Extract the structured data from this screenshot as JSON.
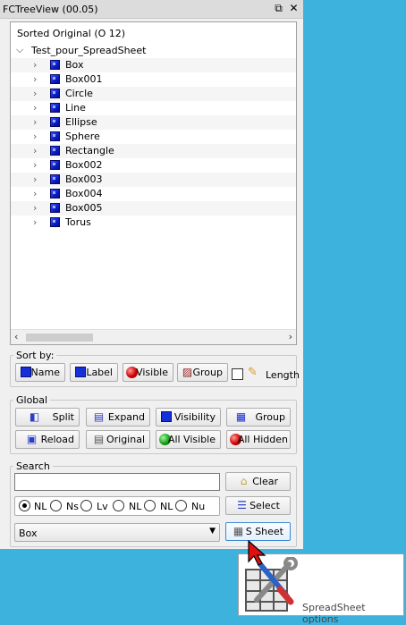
{
  "window": {
    "title": "FCTreeView (00.05)"
  },
  "tree": {
    "header": "Sorted Original (O 12)",
    "root": "Test_pour_SpreadSheet",
    "items": [
      "Box",
      "Box001",
      "Circle",
      "Line",
      "Ellipse",
      "Sphere",
      "Rectangle",
      "Box002",
      "Box003",
      "Box004",
      "Box005",
      "Torus"
    ]
  },
  "sort": {
    "legend": "Sort by:",
    "name": "Name",
    "label": "Label",
    "visible": "Visible",
    "group": "Group",
    "length": "Length"
  },
  "global": {
    "legend": "Global",
    "split": "Split",
    "expand": "Expand",
    "visibility": "Visibility",
    "group": "Group",
    "reload": "Reload",
    "original": "Original",
    "all_visible": "All Visible",
    "all_hidden": "All Hidden"
  },
  "search": {
    "legend": "Search",
    "value": "",
    "clear": "Clear",
    "select": "Select",
    "ssheet": "S Sheet",
    "radios": [
      "NL",
      "Ns",
      "Lv",
      "NL",
      "NL",
      "Nu"
    ],
    "combo_value": "Box"
  },
  "tooltip": {
    "text": "SpreadSheet options"
  },
  "colors": {
    "background": "#3db2dd",
    "panel": "#f0f0f0",
    "cube": "#1530d8"
  }
}
